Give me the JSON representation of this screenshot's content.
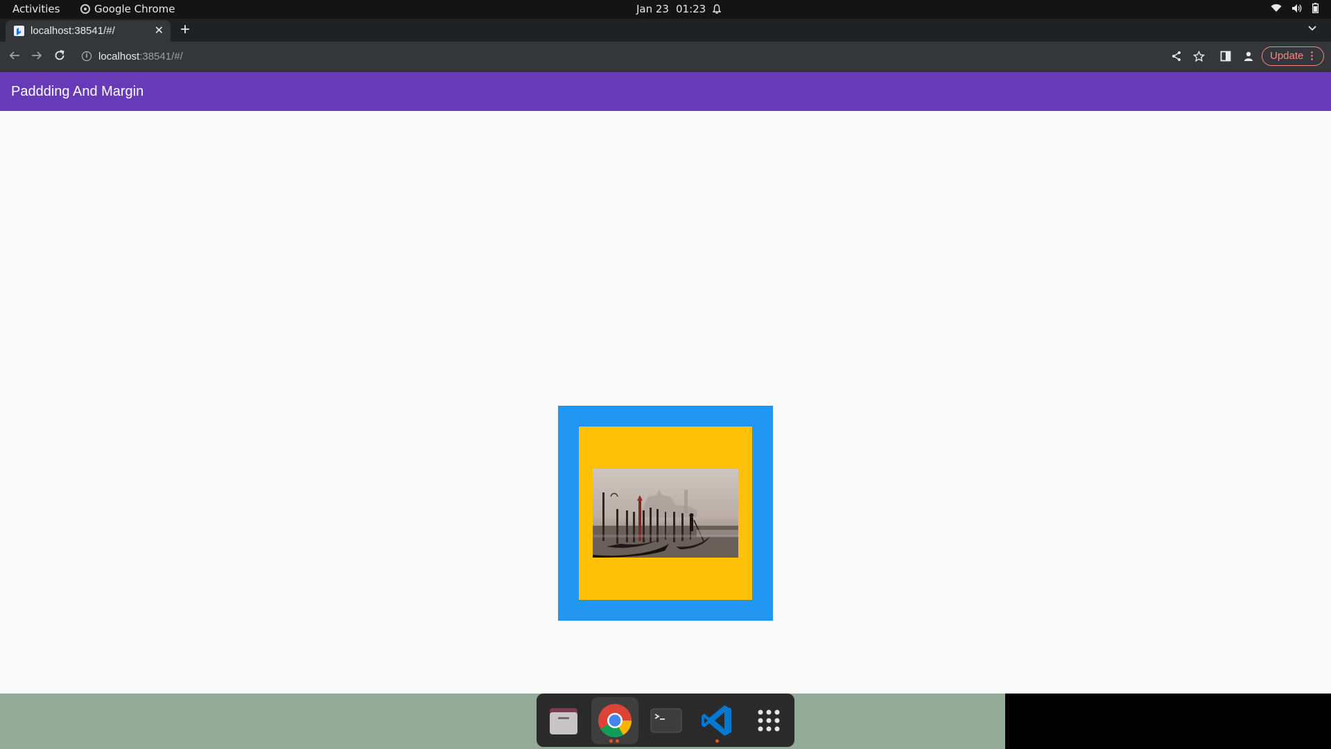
{
  "topbar": {
    "activities": "Activities",
    "app_name": "Google Chrome",
    "date": "Jan 23",
    "time": "01:23"
  },
  "browser": {
    "tab_title": "localhost:38541/#/",
    "url_host": "localhost",
    "url_rest": ":38541/#/",
    "update_label": "Update"
  },
  "app": {
    "title": "Paddding And Margin",
    "colors": {
      "appbar": "#673ab7",
      "outer_box": "#2196f3",
      "inner_box": "#ffc107"
    }
  },
  "dock": {
    "items": [
      "files-icon",
      "chrome-icon",
      "terminal-icon",
      "vscode-icon",
      "app-grid-icon"
    ]
  }
}
